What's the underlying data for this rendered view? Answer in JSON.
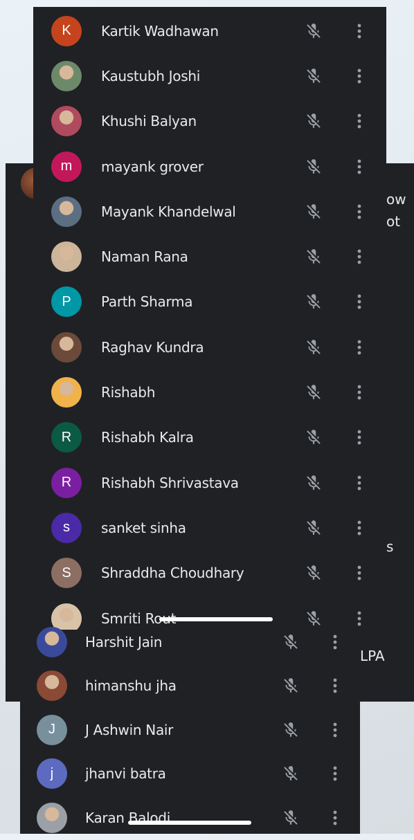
{
  "back_panel": {
    "partial_text": [
      "ow",
      "ot",
      "s",
      "LPA"
    ]
  },
  "top_list": {
    "participants": [
      {
        "name": "Kartik Wadhawan",
        "initial": "K",
        "color": "#c5441e",
        "photo": false
      },
      {
        "name": "Kaustubh Joshi",
        "initial": "",
        "color": "#6c8a6a",
        "photo": true
      },
      {
        "name": "Khushi Balyan",
        "initial": "",
        "color": "#b04a5e",
        "photo": true
      },
      {
        "name": "mayank grover",
        "initial": "m",
        "color": "#c2185b",
        "photo": false
      },
      {
        "name": "Mayank Khandelwal",
        "initial": "",
        "color": "#5b6e82",
        "photo": true
      },
      {
        "name": "Naman Rana",
        "initial": "",
        "color": "#cdb59a",
        "photo": true
      },
      {
        "name": "Parth Sharma",
        "initial": "P",
        "color": "#0097a7",
        "photo": false
      },
      {
        "name": "Raghav Kundra",
        "initial": "",
        "color": "#6b4a3a",
        "photo": true
      },
      {
        "name": "Rishabh",
        "initial": "",
        "color": "#f0b24a",
        "photo": true
      },
      {
        "name": "Rishabh Kalra",
        "initial": "R",
        "color": "#0b5a44",
        "photo": false
      },
      {
        "name": "Rishabh Shrivastava",
        "initial": "R",
        "color": "#7b1fa2",
        "photo": false
      },
      {
        "name": "sanket sinha",
        "initial": "s",
        "color": "#4b2aa8",
        "photo": false
      },
      {
        "name": "Shraddha Choudhary",
        "initial": "S",
        "color": "#8d6e63",
        "photo": false
      },
      {
        "name": "Smriti Rout",
        "initial": "",
        "color": "#d9c3a8",
        "photo": true
      }
    ]
  },
  "bottom_list": {
    "participants": [
      {
        "name": "Harshit Jain",
        "initial": "",
        "color": "#3a4a9a",
        "photo": true
      },
      {
        "name": "himanshu jha",
        "initial": "",
        "color": "#8a4a36",
        "photo": true
      },
      {
        "name": "J Ashwin Nair",
        "initial": "J",
        "color": "#78909c",
        "photo": false
      },
      {
        "name": "jhanvi batra",
        "initial": "j",
        "color": "#5c6bc0",
        "photo": false
      },
      {
        "name": "Karan Balodi",
        "initial": "",
        "color": "#9aa0a6",
        "photo": true
      }
    ]
  },
  "icons": {
    "mic": "mic-off-icon",
    "more": "more-vert-icon"
  },
  "colors": {
    "panel_bg": "#202124",
    "text": "#e8eaed",
    "icon": "#9aa0a6"
  }
}
